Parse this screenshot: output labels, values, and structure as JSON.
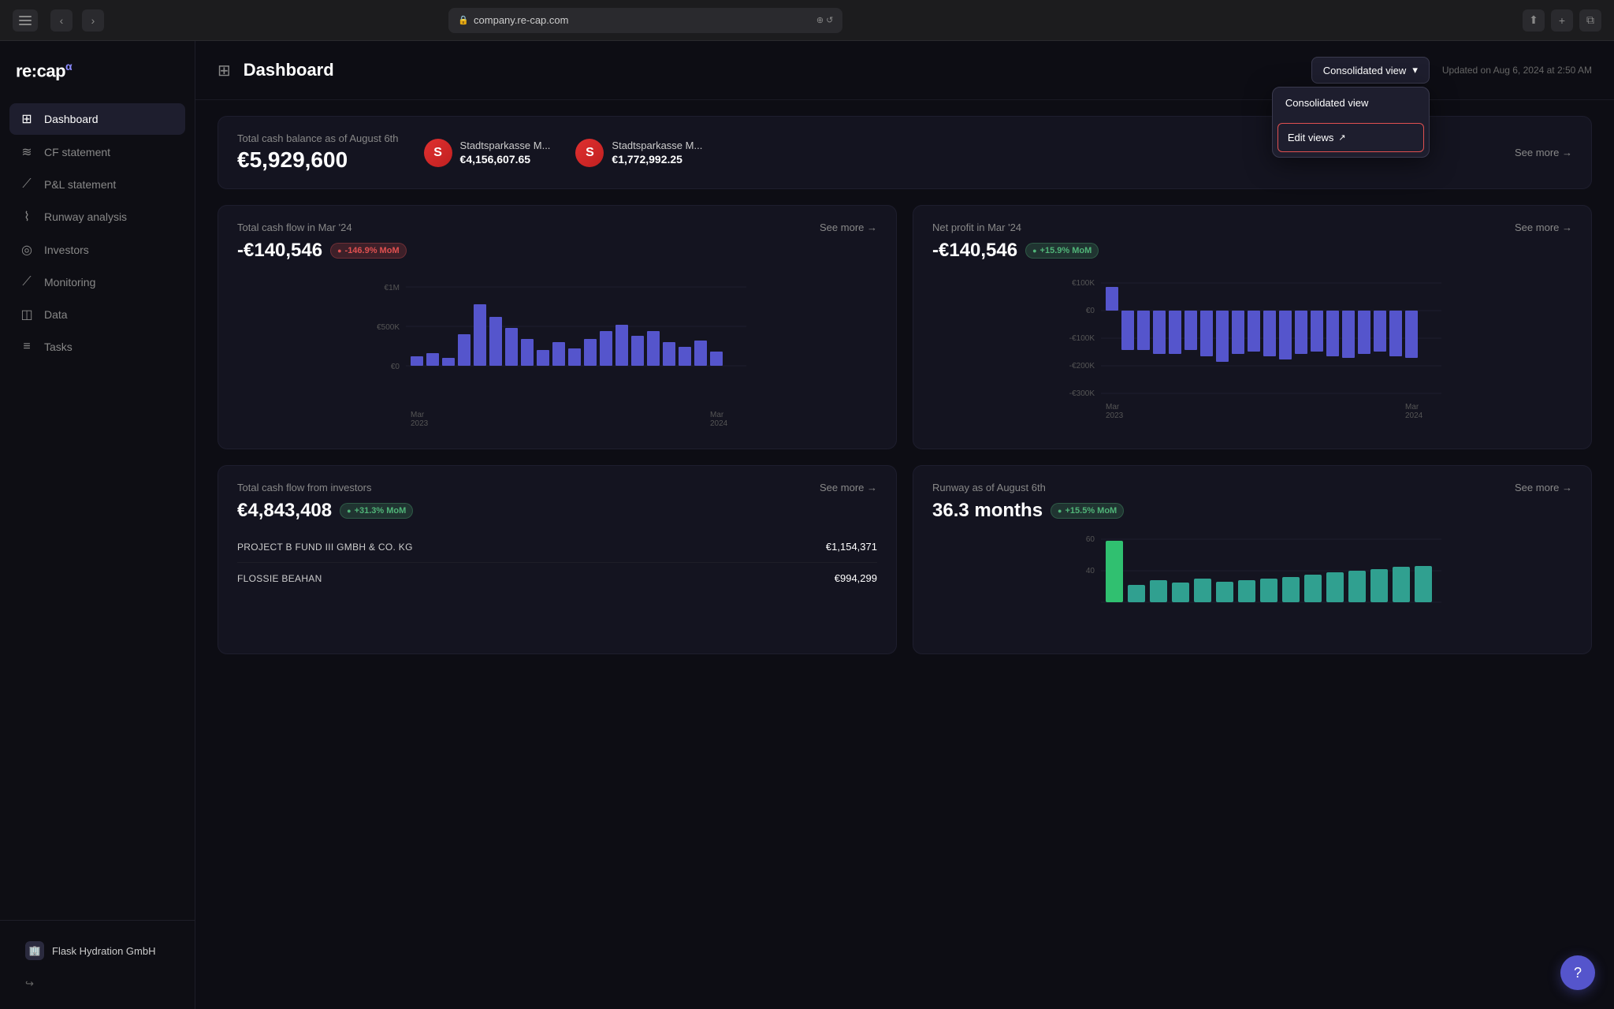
{
  "browser": {
    "url": "company.re-cap.com"
  },
  "logo": {
    "text": "re:cap",
    "sup": "α"
  },
  "sidebar": {
    "items": [
      {
        "id": "dashboard",
        "label": "Dashboard",
        "icon": "⊞",
        "active": true
      },
      {
        "id": "cf-statement",
        "label": "CF statement",
        "icon": "≋",
        "active": false
      },
      {
        "id": "pl-statement",
        "label": "P&L statement",
        "icon": "⟋",
        "active": false
      },
      {
        "id": "runway-analysis",
        "label": "Runway analysis",
        "icon": "⌇",
        "active": false
      },
      {
        "id": "investors",
        "label": "Investors",
        "icon": "◎",
        "active": false
      },
      {
        "id": "monitoring",
        "label": "Monitoring",
        "icon": "⟋",
        "active": false
      },
      {
        "id": "data",
        "label": "Data",
        "icon": "◫",
        "active": false
      },
      {
        "id": "tasks",
        "label": "Tasks",
        "icon": "≡",
        "active": false
      }
    ],
    "company": {
      "name": "Flask Hydration GmbH",
      "icon": "🏢"
    },
    "logout_icon": "↪"
  },
  "header": {
    "title": "Dashboard",
    "grid_icon": "⊞",
    "view_selector": {
      "label": "Consolidated view",
      "chevron": "▾",
      "dropdown": {
        "items": [
          {
            "id": "consolidated",
            "label": "Consolidated view",
            "active": true
          },
          {
            "id": "edit-views",
            "label": "Edit views",
            "icon": "↗",
            "highlight": true
          }
        ]
      }
    },
    "updated_text": "Updated on Aug 6, 2024 at 2:50 AM"
  },
  "cash_balance": {
    "label": "Total cash balance as of August 6th",
    "amount": "€5,929,600",
    "see_more": "See more →",
    "banks": [
      {
        "name": "Stadtsparkasse M...",
        "amount": "€4,156,607.65",
        "logo_letter": "S"
      },
      {
        "name": "Stadtsparkasse M...",
        "amount": "€1,772,992.25",
        "logo_letter": "S"
      }
    ]
  },
  "charts": {
    "cash_flow": {
      "label": "Total cash flow in Mar '24",
      "value": "-€140,546",
      "badge": "-146.9% MoM",
      "badge_type": "negative",
      "see_more": "See more →",
      "y_labels": [
        "€1M",
        "€500K",
        "€0"
      ],
      "x_labels": [
        "Mar\n2023",
        "Mar\n2024"
      ],
      "bars": [
        15,
        18,
        12,
        40,
        80,
        55,
        35,
        25,
        30,
        20,
        45,
        50,
        28,
        22,
        35,
        30,
        48,
        40,
        20,
        15
      ]
    },
    "net_profit": {
      "label": "Net profit in Mar '24",
      "value": "-€140,546",
      "badge": "+15.9% MoM",
      "badge_type": "positive",
      "see_more": "See more →",
      "y_labels": [
        "€100K",
        "€0",
        "-€100K",
        "-€200K",
        "-€300K"
      ],
      "x_labels": [
        "Mar\n2023",
        "Mar\n2024"
      ],
      "bars": [
        85,
        35,
        35,
        40,
        42,
        38,
        45,
        50,
        40,
        38,
        42,
        45,
        40,
        38,
        42,
        44,
        40,
        38,
        42,
        44
      ]
    }
  },
  "investor_cashflow": {
    "label": "Total cash flow from investors",
    "value": "€4,843,408",
    "badge": "+31.3% MoM",
    "badge_type": "positive",
    "see_more": "See more →",
    "rows": [
      {
        "name": "PROJECT B FUND III GMBH & CO. KG",
        "amount": "€1,154,371"
      },
      {
        "name": "FLOSSIE BEAHAN",
        "amount": "€994,299"
      }
    ]
  },
  "runway": {
    "label": "Runway as of August 6th",
    "value": "36.3 months",
    "badge": "+15.5% MoM",
    "badge_type": "positive",
    "see_more": "See more →",
    "y_labels": [
      "60",
      "40"
    ]
  },
  "help": {
    "icon": "?"
  }
}
